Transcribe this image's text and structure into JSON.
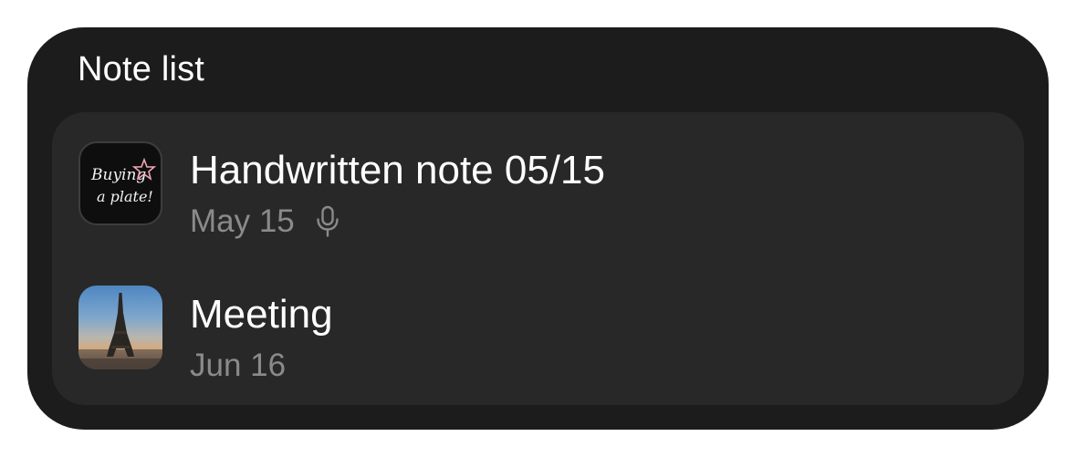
{
  "widget": {
    "title": "Note list"
  },
  "notes": [
    {
      "title": "Handwritten note 05/15",
      "date": "May 15",
      "has_voice_recording": true,
      "thumbnail": {
        "type": "handwriting",
        "lines": [
          "Buying",
          "a plate!"
        ]
      }
    },
    {
      "title": "Meeting",
      "date": "Jun 16",
      "has_voice_recording": false,
      "thumbnail": {
        "type": "photo",
        "subject": "eiffel-tower"
      }
    }
  ],
  "icons": {
    "voice": "mic-icon"
  },
  "colors": {
    "widget_background": "#1c1c1c",
    "panel_background": "#282828",
    "title_text": "#ffffff",
    "secondary_text": "#8a8a8a"
  }
}
